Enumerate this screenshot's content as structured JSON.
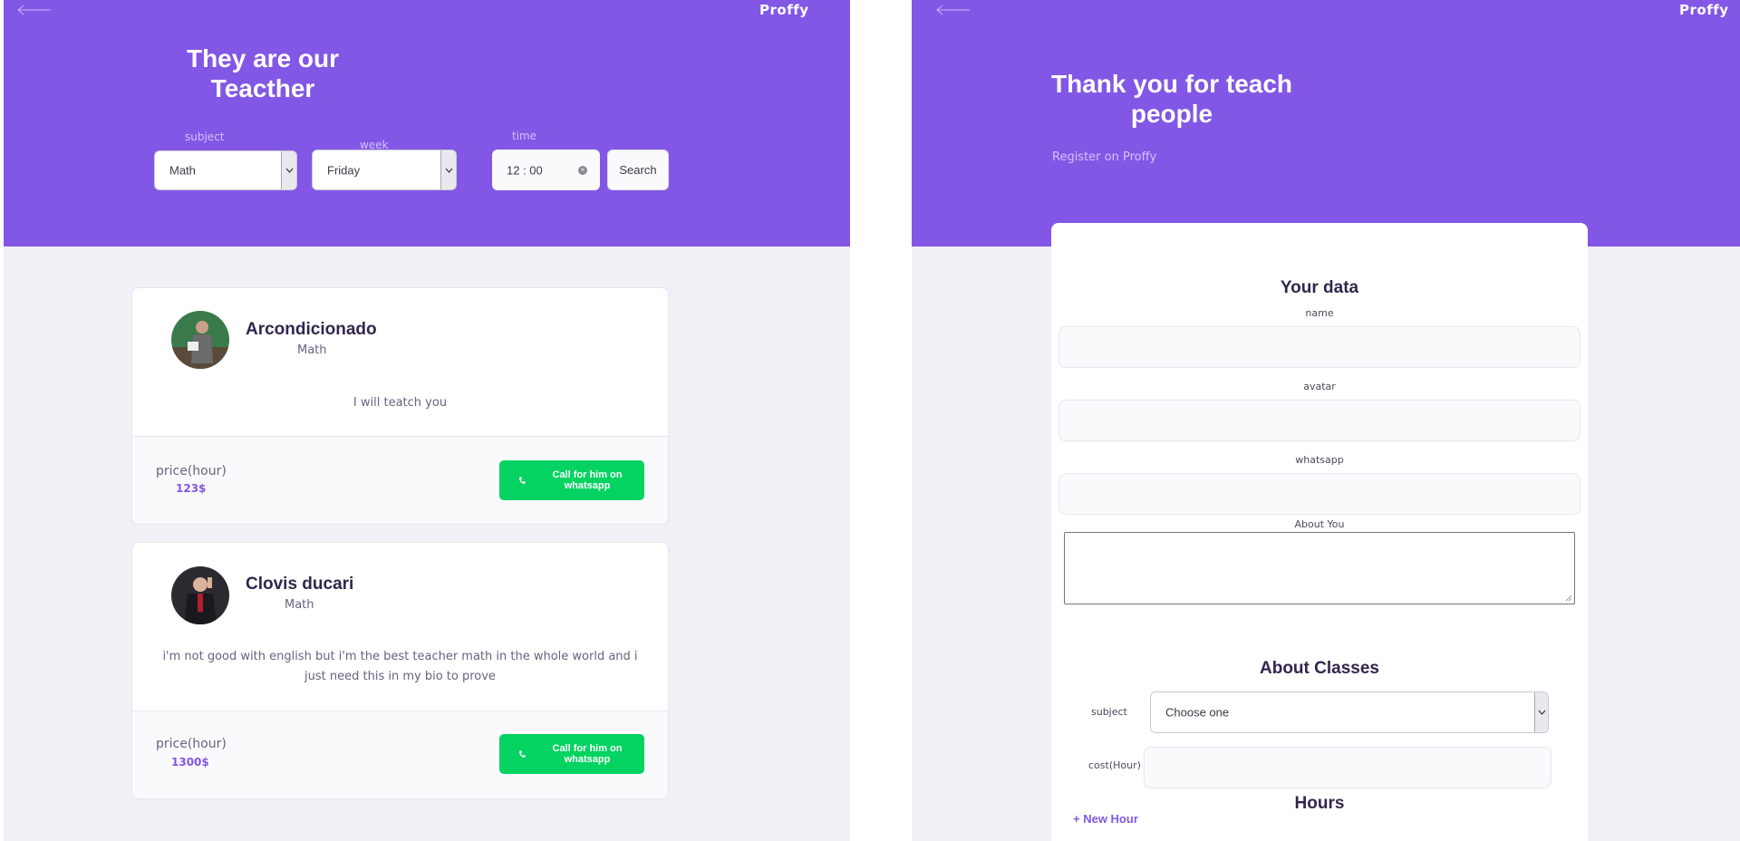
{
  "colors": {
    "primary": "#8257e5",
    "background": "#f0f0f7",
    "whatsapp_green": "#04d361",
    "title_text": "#32264d"
  },
  "left": {
    "brand": "Proffy",
    "back_icon": "arrow-left-icon",
    "title_line1": "They are our",
    "title_line2": "Teacther",
    "filters": {
      "subject_label": "subject",
      "subject_value": "Math",
      "week_label": "week",
      "week_value": "Friday",
      "time_label": "time",
      "time_value": "12 : 00",
      "search_label": "Search"
    },
    "teachers": [
      {
        "name": "Arcondicionado",
        "subject": "Math",
        "bio": "I will teatch you",
        "price_label": "price(hour)",
        "price": "123$",
        "cta": "Call for him on whatsapp"
      },
      {
        "name": "Clovis ducari",
        "subject": "Math",
        "bio": "i'm not good with english but i'm the best teacher math in the whole world and i just need this in my bio to prove",
        "price_label": "price(hour)",
        "price": "1300$",
        "cta": "Call for him on whatsapp"
      }
    ]
  },
  "right": {
    "brand": "Proffy",
    "back_icon": "arrow-left-icon",
    "title_line1": "Thank you for teach",
    "title_line2": "people",
    "subtitle": "Register on Proffy",
    "your_data": {
      "title": "Your data",
      "name_label": "name",
      "avatar_label": "avatar",
      "whatsapp_label": "whatsapp",
      "about_label": "About You"
    },
    "about_classes": {
      "title": "About Classes",
      "subject_label": "subject",
      "subject_placeholder": "Choose one",
      "cost_label": "cost(Hour)"
    },
    "hours": {
      "title": "Hours",
      "new_hour": "+ New Hour"
    }
  }
}
